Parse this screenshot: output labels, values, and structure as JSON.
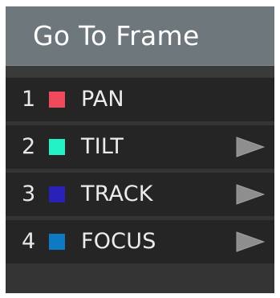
{
  "header": {
    "title": "Go To Frame"
  },
  "rows": [
    {
      "number": "1",
      "label": "PAN",
      "color": "#ef4a5b",
      "has_arrow": false
    },
    {
      "number": "2",
      "label": "TILT",
      "color": "#22f2c6",
      "has_arrow": true
    },
    {
      "number": "3",
      "label": "TRACK",
      "color": "#2a22b8",
      "has_arrow": true
    },
    {
      "number": "4",
      "label": "FOCUS",
      "color": "#0f7ac4",
      "has_arrow": true
    }
  ],
  "icons": {
    "arrow": "play-arrow-icon"
  }
}
